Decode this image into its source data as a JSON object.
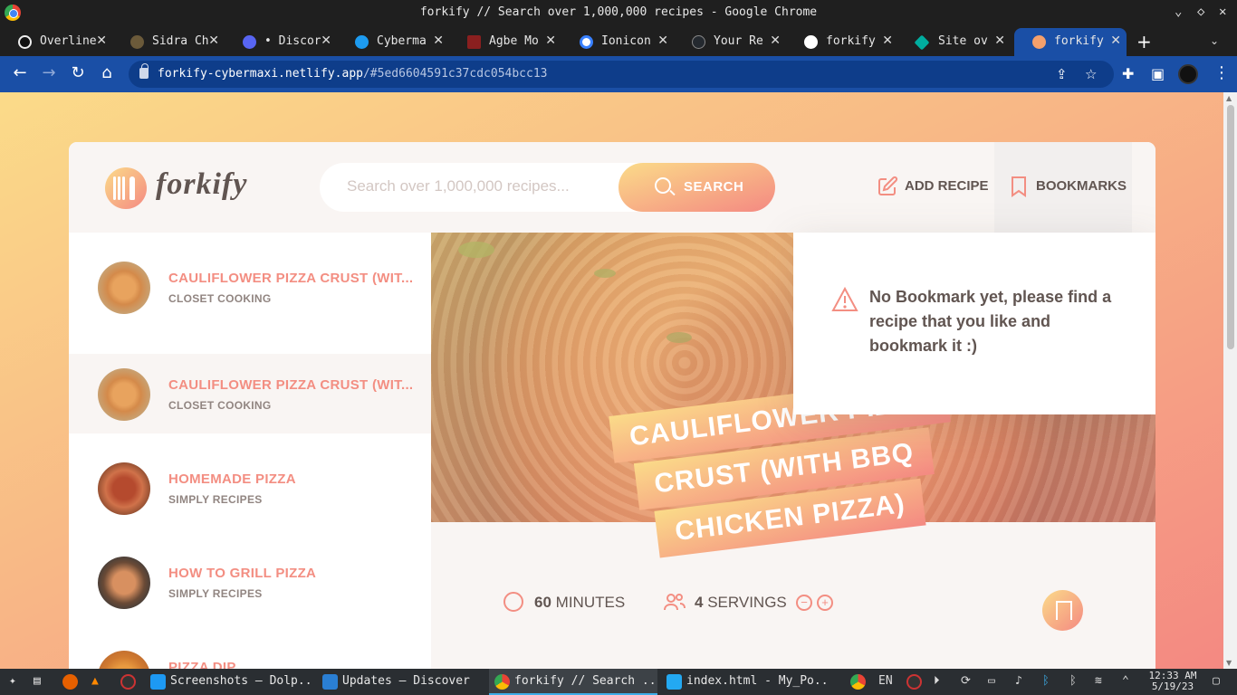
{
  "window": {
    "title": "forkify // Search over 1,000,000 recipes - Google Chrome",
    "controls": [
      "⌄",
      "◇",
      "✕"
    ]
  },
  "tabs": [
    {
      "label": "Overline",
      "favicon_color": "#111111",
      "icon": "overline-icon"
    },
    {
      "label": "Sidra Ch",
      "favicon_color": "#6b5a3a",
      "icon": "sidra-icon"
    },
    {
      "label": "• Discord",
      "favicon_color": "#5865f2",
      "icon": "discord-icon"
    },
    {
      "label": "Cyberma",
      "favicon_color": "#1d9bf0",
      "icon": "twitter-icon"
    },
    {
      "label": "Agbe Mo",
      "favicon_color": "#8a1f1f",
      "icon": "agbe-icon"
    },
    {
      "label": "Ionicon",
      "favicon_color": "#3880ff",
      "icon": "ionicons-icon"
    },
    {
      "label": "Your Re",
      "favicon_color": "#24292f",
      "icon": "github-icon"
    },
    {
      "label": "forkify",
      "favicon_color": "#000000",
      "icon": "vercel-icon"
    },
    {
      "label": "Site ov",
      "favicon_color": "#00ad9f",
      "icon": "netlify-icon"
    },
    {
      "label": "forkify",
      "favicon_color": "#f4a06c",
      "icon": "forkify-icon",
      "active": true
    }
  ],
  "address_bar": {
    "host": "forkify-cybermaxi.netlify.app",
    "path": "/#5ed6604591c37cdc054bcc13"
  },
  "app": {
    "logo_text": "forkify",
    "search": {
      "placeholder": "Search over 1,000,000 recipes...",
      "value": "",
      "button_label": "SEARCH"
    },
    "nav": {
      "add_recipe": "ADD RECIPE",
      "bookmarks": "BOOKMARKS"
    },
    "results": [
      {
        "title": "CAULIFLOWER PIZZA CRUST (WIT...",
        "publisher": "CLOSET COOKING",
        "active": false
      },
      {
        "title": "CAULIFLOWER PIZZA CRUST (WIT...",
        "publisher": "CLOSET COOKING",
        "active": true
      },
      {
        "title": "HOMEMADE PIZZA",
        "publisher": "SIMPLY RECIPES",
        "active": false
      },
      {
        "title": "HOW TO GRILL PIZZA",
        "publisher": "SIMPLY RECIPES",
        "active": false
      },
      {
        "title": "PIZZA DIP",
        "publisher": "",
        "active": false
      }
    ],
    "recipe": {
      "title_lines": [
        "CAULIFLOWER PIZZA",
        "CRUST (WITH BBQ",
        "CHICKEN PIZZA)"
      ],
      "minutes_value": "60",
      "minutes_label": "MINUTES",
      "servings_value": "4",
      "servings_label": "SERVINGS"
    },
    "bookmarks_panel": {
      "message": "No Bookmark yet, please find a recipe that you like and bookmark it :)"
    },
    "colors": {
      "primary": "#f38e82",
      "grad_start": "#fbdb89",
      "grad_end": "#f48982",
      "text": "#615551"
    }
  },
  "taskbar": {
    "items": [
      {
        "label": "Screenshots — Dolp...",
        "icon": "dolphin-icon",
        "color": "#1d99f3"
      },
      {
        "label": "Updates — Discover",
        "icon": "discover-icon",
        "color": "#2a7fd4"
      },
      {
        "label": "forkify // Search ...",
        "icon": "chrome-icon",
        "color": "#34a853",
        "active": true
      },
      {
        "label": "index.html - My_Po...",
        "icon": "vscode-icon",
        "color": "#23a9f2"
      }
    ],
    "lang": "EN",
    "time": "12:33 AM",
    "date": "5/19/23"
  }
}
